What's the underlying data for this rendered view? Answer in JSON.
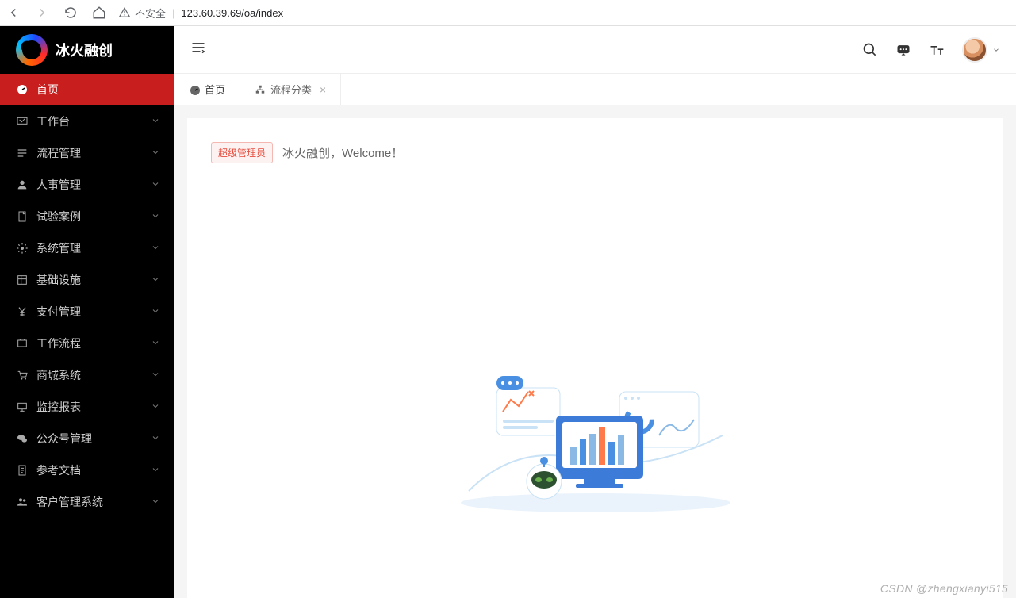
{
  "browser": {
    "insecure_label": "不安全",
    "url": "123.60.39.69/oa/index"
  },
  "brand": {
    "name": "冰火融创"
  },
  "sidebar": {
    "items": [
      {
        "label": "首页",
        "icon": "dashboard-icon",
        "active": true,
        "expandable": false
      },
      {
        "label": "工作台",
        "icon": "desk-icon",
        "active": false,
        "expandable": true
      },
      {
        "label": "流程管理",
        "icon": "list-icon",
        "active": false,
        "expandable": true
      },
      {
        "label": "人事管理",
        "icon": "person-icon",
        "active": false,
        "expandable": true
      },
      {
        "label": "试验案例",
        "icon": "case-icon",
        "active": false,
        "expandable": true
      },
      {
        "label": "系统管理",
        "icon": "gear-icon",
        "active": false,
        "expandable": true
      },
      {
        "label": "基础设施",
        "icon": "infra-icon",
        "active": false,
        "expandable": true
      },
      {
        "label": "支付管理",
        "icon": "yen-icon",
        "active": false,
        "expandable": true
      },
      {
        "label": "工作流程",
        "icon": "workflow-icon",
        "active": false,
        "expandable": true
      },
      {
        "label": "商城系统",
        "icon": "cart-icon",
        "active": false,
        "expandable": true
      },
      {
        "label": "监控报表",
        "icon": "monitor-icon",
        "active": false,
        "expandable": true
      },
      {
        "label": "公众号管理",
        "icon": "wechat-icon",
        "active": false,
        "expandable": true
      },
      {
        "label": "参考文档",
        "icon": "doc-icon",
        "active": false,
        "expandable": true
      },
      {
        "label": "客户管理系统",
        "icon": "users-icon",
        "active": false,
        "expandable": true
      }
    ]
  },
  "tabs": [
    {
      "label": "首页",
      "closable": false,
      "active": true,
      "icon": "dashboard-icon"
    },
    {
      "label": "流程分类",
      "closable": true,
      "active": false,
      "icon": "sitemap-icon"
    }
  ],
  "content": {
    "role_badge": "超级管理员",
    "welcome": "冰火融创，Welcome！"
  },
  "watermark": "CSDN @zhengxianyi515"
}
